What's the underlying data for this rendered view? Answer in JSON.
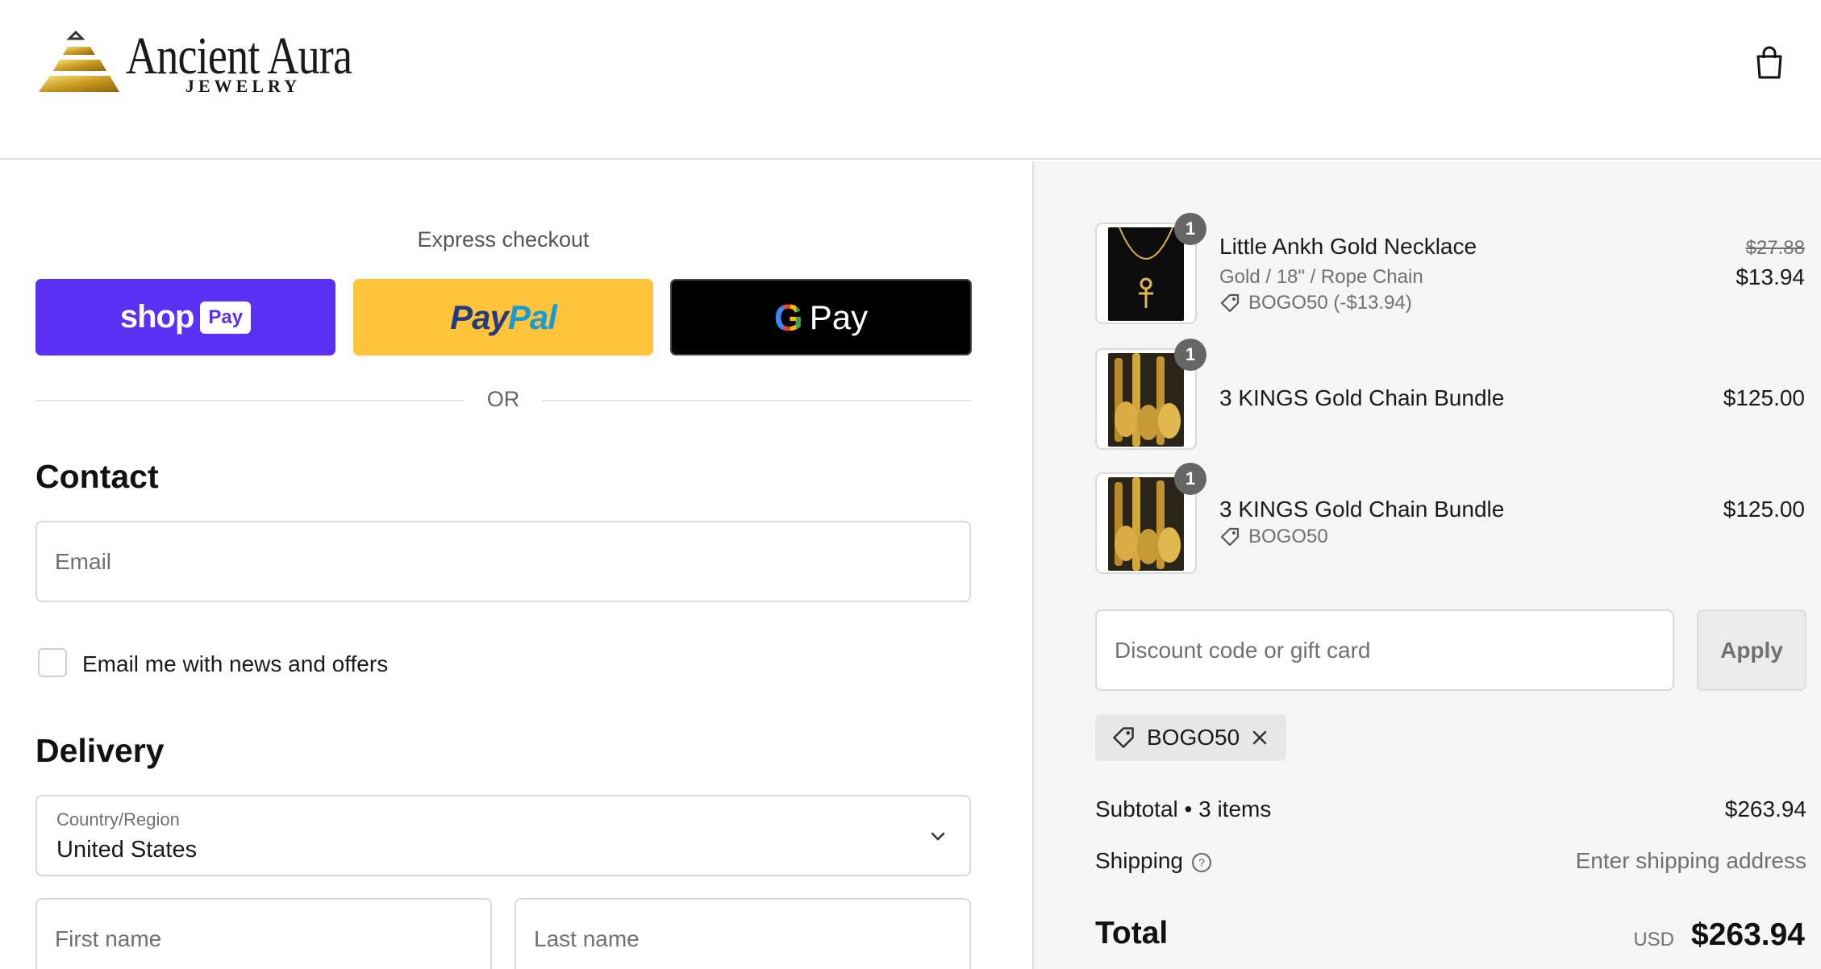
{
  "brand": {
    "name": "Ancient Aura",
    "tagline": "JEWELRY"
  },
  "header": {
    "cart_icon": "shopping-bag-icon"
  },
  "express": {
    "title": "Express checkout",
    "shop_pay": {
      "word": "shop",
      "badge": "Pay"
    },
    "paypal": {
      "part1": "Pay",
      "part2": "Pal"
    },
    "gpay": {
      "g": "G",
      "word": "Pay"
    },
    "divider": "OR"
  },
  "contact": {
    "title": "Contact",
    "email_placeholder": "Email",
    "newsletter_label": "Email me with news and offers",
    "newsletter_checked": false
  },
  "delivery": {
    "title": "Delivery",
    "country_label": "Country/Region",
    "country_value": "United States",
    "first_name_placeholder": "First name",
    "last_name_placeholder": "Last name"
  },
  "cart": {
    "items": [
      {
        "qty": "1",
        "name": "Little Ankh Gold Necklace",
        "variant": "Gold / 18\" / Rope Chain",
        "discount": "BOGO50 (-$13.94)",
        "old_price": "$27.88",
        "price": "$13.94"
      },
      {
        "qty": "1",
        "name": "3 KINGS Gold Chain Bundle",
        "price": "$125.00"
      },
      {
        "qty": "1",
        "name": "3 KINGS Gold Chain Bundle",
        "discount": "BOGO50",
        "price": "$125.00"
      }
    ],
    "discount_placeholder": "Discount code or gift card",
    "apply_label": "Apply",
    "applied_code": "BOGO50",
    "subtotal_label": "Subtotal • 3 items",
    "subtotal_value": "$263.94",
    "shipping_label": "Shipping",
    "shipping_value": "Enter shipping address",
    "total_label": "Total",
    "total_currency": "USD",
    "total_value": "$263.94"
  },
  "colors": {
    "shop_pay": "#5a31f4",
    "paypal": "#ffc439",
    "gpay": "#000000",
    "summary_bg": "#f5f5f5"
  }
}
